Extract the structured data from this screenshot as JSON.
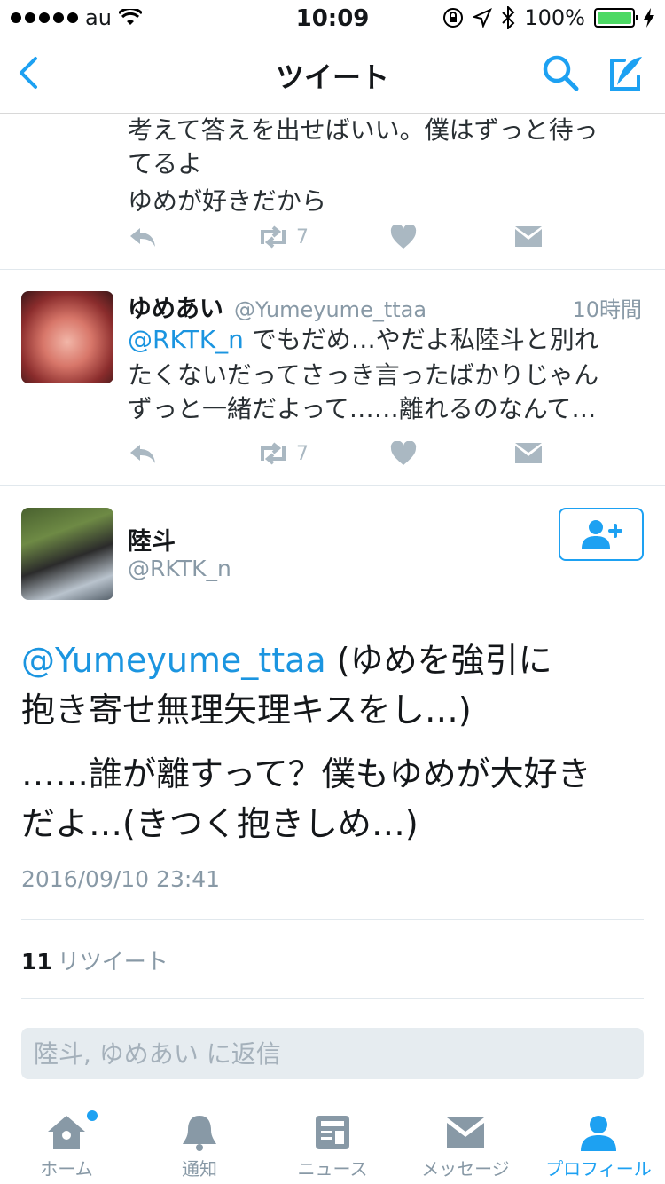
{
  "status_bar": {
    "carrier": "au",
    "time": "10:09",
    "battery": "100%"
  },
  "nav": {
    "title": "ツイート"
  },
  "tweet_top": {
    "lines": [
      "考えて答えを出せばいい。僕はずっと待っ",
      "てるよ",
      "ゆめが好きだから"
    ],
    "retweet_count": "7"
  },
  "tweet_mid": {
    "name": "ゆめあい",
    "handle": "@Yumeyume_ttaa",
    "time": "10時間",
    "mention": "@RKTK_n",
    "line1_rest": " でもだめ…やだよ私陸斗と別れ",
    "line2": "たくないだってさっき言ったばかりじゃん",
    "line3": "ずっと一緒だよって……離れるのなんて…",
    "retweet_count": "7"
  },
  "detail": {
    "name": "陸斗",
    "handle": "@RKTK_n",
    "mention": "@Yumeyume_ttaa",
    "line1_rest": " (ゆめを強引に",
    "line2": "抱き寄せ無理矢理キスをし…)",
    "line3": "……誰が離すって？僕もゆめが大好き",
    "line4": "だよ…(きつく抱きしめ…)",
    "date": "2016/09/10 23:41",
    "retweets_count": "11",
    "retweets_label": "リツイート"
  },
  "reply": {
    "placeholder": "陸斗, ゆめあい に返信"
  },
  "tabs": [
    {
      "label": "ホーム",
      "icon": "home-icon"
    },
    {
      "label": "通知",
      "icon": "bell-icon"
    },
    {
      "label": "ニュース",
      "icon": "news-icon"
    },
    {
      "label": "メッセージ",
      "icon": "envelope-icon"
    },
    {
      "label": "プロフィール",
      "icon": "profile-icon"
    }
  ],
  "colors": {
    "accent": "#1da1f2",
    "mention": "#1b95e0",
    "muted": "#8899a6",
    "action_gray": "#aab8c2"
  }
}
